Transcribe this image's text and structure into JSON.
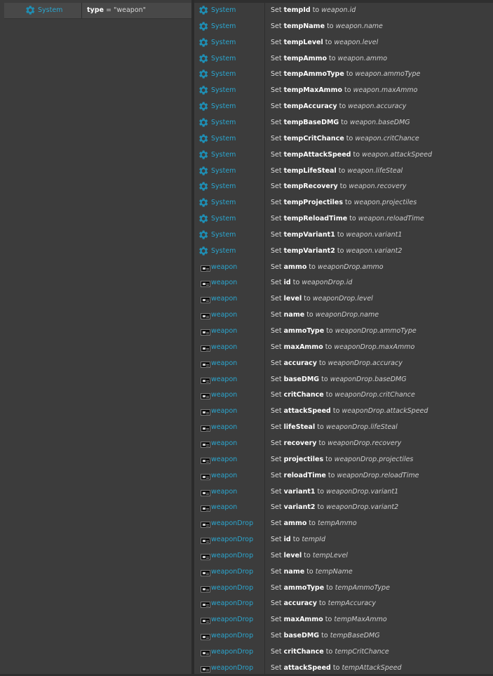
{
  "condition": {
    "object": "System",
    "icon": "gear-icon",
    "param_name": "type",
    "param_op": " = ",
    "param_value": "\"weapon\""
  },
  "colors": {
    "object_name": "#2ba6cf",
    "gear": "#1e8fb5",
    "panel": "#3c3c3c",
    "background": "#2f2f2f"
  },
  "actions": [
    {
      "object": "System",
      "icon": "gear-icon",
      "verb": "Set",
      "var": "tempId",
      "to": "to",
      "expr": "weapon.id"
    },
    {
      "object": "System",
      "icon": "gear-icon",
      "verb": "Set",
      "var": "tempName",
      "to": "to",
      "expr": "weapon.name"
    },
    {
      "object": "System",
      "icon": "gear-icon",
      "verb": "Set",
      "var": "tempLevel",
      "to": "to",
      "expr": "weapon.level"
    },
    {
      "object": "System",
      "icon": "gear-icon",
      "verb": "Set",
      "var": "tempAmmo",
      "to": "to",
      "expr": "weapon.ammo"
    },
    {
      "object": "System",
      "icon": "gear-icon",
      "verb": "Set",
      "var": "tempAmmoType",
      "to": "to",
      "expr": "weapon.ammoType"
    },
    {
      "object": "System",
      "icon": "gear-icon",
      "verb": "Set",
      "var": "tempMaxAmmo",
      "to": "to",
      "expr": "weapon.maxAmmo"
    },
    {
      "object": "System",
      "icon": "gear-icon",
      "verb": "Set",
      "var": "tempAccuracy",
      "to": "to",
      "expr": "weapon.accuracy"
    },
    {
      "object": "System",
      "icon": "gear-icon",
      "verb": "Set",
      "var": "tempBaseDMG",
      "to": "to",
      "expr": "weapon.baseDMG"
    },
    {
      "object": "System",
      "icon": "gear-icon",
      "verb": "Set",
      "var": "tempCritChance",
      "to": "to",
      "expr": "weapon.critChance"
    },
    {
      "object": "System",
      "icon": "gear-icon",
      "verb": "Set",
      "var": "tempAttackSpeed",
      "to": "to",
      "expr": "weapon.attackSpeed"
    },
    {
      "object": "System",
      "icon": "gear-icon",
      "verb": "Set",
      "var": "tempLifeSteal",
      "to": "to",
      "expr": "weapon.lifeSteal"
    },
    {
      "object": "System",
      "icon": "gear-icon",
      "verb": "Set",
      "var": "tempRecovery",
      "to": "to",
      "expr": "weapon.recovery"
    },
    {
      "object": "System",
      "icon": "gear-icon",
      "verb": "Set",
      "var": "tempProjectiles",
      "to": "to",
      "expr": "weapon.projectiles"
    },
    {
      "object": "System",
      "icon": "gear-icon",
      "verb": "Set",
      "var": "tempReloadTime",
      "to": "to",
      "expr": "weapon.reloadTime"
    },
    {
      "object": "System",
      "icon": "gear-icon",
      "verb": "Set",
      "var": "tempVariant1",
      "to": "to",
      "expr": "weapon.variant1"
    },
    {
      "object": "System",
      "icon": "gear-icon",
      "verb": "Set",
      "var": "tempVariant2",
      "to": "to",
      "expr": "weapon.variant2"
    },
    {
      "object": "weapon",
      "icon": "instance-vars-icon",
      "verb": "Set",
      "var": "ammo",
      "to": "to",
      "expr": "weaponDrop.ammo"
    },
    {
      "object": "weapon",
      "icon": "instance-vars-icon",
      "verb": "Set",
      "var": "id",
      "to": "to",
      "expr": "weaponDrop.id"
    },
    {
      "object": "weapon",
      "icon": "instance-vars-icon",
      "verb": "Set",
      "var": "level",
      "to": "to",
      "expr": "weaponDrop.level"
    },
    {
      "object": "weapon",
      "icon": "instance-vars-icon",
      "verb": "Set",
      "var": "name",
      "to": "to",
      "expr": "weaponDrop.name"
    },
    {
      "object": "weapon",
      "icon": "instance-vars-icon",
      "verb": "Set",
      "var": "ammoType",
      "to": "to",
      "expr": "weaponDrop.ammoType"
    },
    {
      "object": "weapon",
      "icon": "instance-vars-icon",
      "verb": "Set",
      "var": "maxAmmo",
      "to": "to",
      "expr": "weaponDrop.maxAmmo"
    },
    {
      "object": "weapon",
      "icon": "instance-vars-icon",
      "verb": "Set",
      "var": "accuracy",
      "to": "to",
      "expr": "weaponDrop.accuracy"
    },
    {
      "object": "weapon",
      "icon": "instance-vars-icon",
      "verb": "Set",
      "var": "baseDMG",
      "to": "to",
      "expr": "weaponDrop.baseDMG"
    },
    {
      "object": "weapon",
      "icon": "instance-vars-icon",
      "verb": "Set",
      "var": "critChance",
      "to": "to",
      "expr": "weaponDrop.critChance"
    },
    {
      "object": "weapon",
      "icon": "instance-vars-icon",
      "verb": "Set",
      "var": "attackSpeed",
      "to": "to",
      "expr": "weaponDrop.attackSpeed"
    },
    {
      "object": "weapon",
      "icon": "instance-vars-icon",
      "verb": "Set",
      "var": "lifeSteal",
      "to": "to",
      "expr": "weaponDrop.lifeSteal"
    },
    {
      "object": "weapon",
      "icon": "instance-vars-icon",
      "verb": "Set",
      "var": "recovery",
      "to": "to",
      "expr": "weaponDrop.recovery"
    },
    {
      "object": "weapon",
      "icon": "instance-vars-icon",
      "verb": "Set",
      "var": "projectiles",
      "to": "to",
      "expr": "weaponDrop.projectiles"
    },
    {
      "object": "weapon",
      "icon": "instance-vars-icon",
      "verb": "Set",
      "var": "reloadTime",
      "to": "to",
      "expr": "weaponDrop.reloadTime"
    },
    {
      "object": "weapon",
      "icon": "instance-vars-icon",
      "verb": "Set",
      "var": "variant1",
      "to": "to",
      "expr": "weaponDrop.variant1"
    },
    {
      "object": "weapon",
      "icon": "instance-vars-icon",
      "verb": "Set",
      "var": "variant2",
      "to": "to",
      "expr": "weaponDrop.variant2"
    },
    {
      "object": "weaponDrop",
      "icon": "instance-vars-icon",
      "verb": "Set",
      "var": "ammo",
      "to": "to",
      "expr": "tempAmmo"
    },
    {
      "object": "weaponDrop",
      "icon": "instance-vars-icon",
      "verb": "Set",
      "var": "id",
      "to": "to",
      "expr": "tempId"
    },
    {
      "object": "weaponDrop",
      "icon": "instance-vars-icon",
      "verb": "Set",
      "var": "level",
      "to": "to",
      "expr": "tempLevel"
    },
    {
      "object": "weaponDrop",
      "icon": "instance-vars-icon",
      "verb": "Set",
      "var": "name",
      "to": "to",
      "expr": "tempName"
    },
    {
      "object": "weaponDrop",
      "icon": "instance-vars-icon",
      "verb": "Set",
      "var": "ammoType",
      "to": "to",
      "expr": "tempAmmoType"
    },
    {
      "object": "weaponDrop",
      "icon": "instance-vars-icon",
      "verb": "Set",
      "var": "accuracy",
      "to": "to",
      "expr": "tempAccuracy"
    },
    {
      "object": "weaponDrop",
      "icon": "instance-vars-icon",
      "verb": "Set",
      "var": "maxAmmo",
      "to": "to",
      "expr": "tempMaxAmmo"
    },
    {
      "object": "weaponDrop",
      "icon": "instance-vars-icon",
      "verb": "Set",
      "var": "baseDMG",
      "to": "to",
      "expr": "tempBaseDMG"
    },
    {
      "object": "weaponDrop",
      "icon": "instance-vars-icon",
      "verb": "Set",
      "var": "critChance",
      "to": "to",
      "expr": "tempCritChance"
    },
    {
      "object": "weaponDrop",
      "icon": "instance-vars-icon",
      "verb": "Set",
      "var": "attackSpeed",
      "to": "to",
      "expr": "tempAttackSpeed"
    }
  ]
}
